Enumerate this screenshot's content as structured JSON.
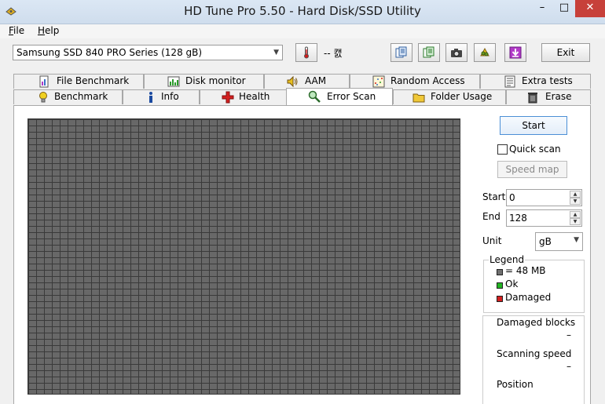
{
  "window": {
    "title": "HD Tune Pro 5.50 - Hard Disk/SSD Utility",
    "min_glyph": "–",
    "max_glyph": "□",
    "close_glyph": "✕"
  },
  "menu": [
    {
      "label": "File",
      "mnemonic": "F",
      "rest": "ile"
    },
    {
      "label": "Help",
      "mnemonic": "H",
      "rest": "elp"
    }
  ],
  "toolbar": {
    "drive": "Samsung SSD 840 PRO Series (128 gB)",
    "temperature": "-- 캜",
    "exit_label": "Exit",
    "icons": [
      "thermometer-icon",
      "copy-info-icon",
      "copy-text-icon",
      "screenshot-icon",
      "options-icon",
      "download-icon"
    ]
  },
  "tabs_top": [
    {
      "label": "File Benchmark",
      "icon": "file-benchmark-icon"
    },
    {
      "label": "Disk monitor",
      "icon": "disk-monitor-icon"
    },
    {
      "label": "AAM",
      "icon": "speaker-icon"
    },
    {
      "label": "Random Access",
      "icon": "random-access-icon"
    },
    {
      "label": "Extra tests",
      "icon": "extra-tests-icon"
    }
  ],
  "tabs_bottom": [
    {
      "label": "Benchmark",
      "icon": "bulb-icon"
    },
    {
      "label": "Info",
      "icon": "info-icon"
    },
    {
      "label": "Health",
      "icon": "health-cross-icon"
    },
    {
      "label": "Error Scan",
      "icon": "magnifier-icon",
      "active": true
    },
    {
      "label": "Folder Usage",
      "icon": "folder-icon"
    },
    {
      "label": "Erase",
      "icon": "trash-icon"
    }
  ],
  "scan": {
    "start_label": "Start",
    "quick_scan_label": "Quick scan",
    "quick_scan_checked": false,
    "speed_map_label": "Speed map",
    "start_field_label": "Start",
    "start_value": "0",
    "end_field_label": "End",
    "end_value": "128",
    "unit_label": "Unit",
    "unit_value": "gB"
  },
  "legend": {
    "title": "Legend",
    "items": [
      {
        "label": "= 48 MB",
        "color": "#707070"
      },
      {
        "label": "Ok",
        "color": "#22b422"
      },
      {
        "label": "Damaged",
        "color": "#d42020"
      }
    ]
  },
  "stats": {
    "damaged_blocks_label": "Damaged blocks",
    "damaged_blocks_value": "–",
    "scanning_speed_label": "Scanning speed",
    "scanning_speed_value": "–",
    "position_label": "Position"
  }
}
